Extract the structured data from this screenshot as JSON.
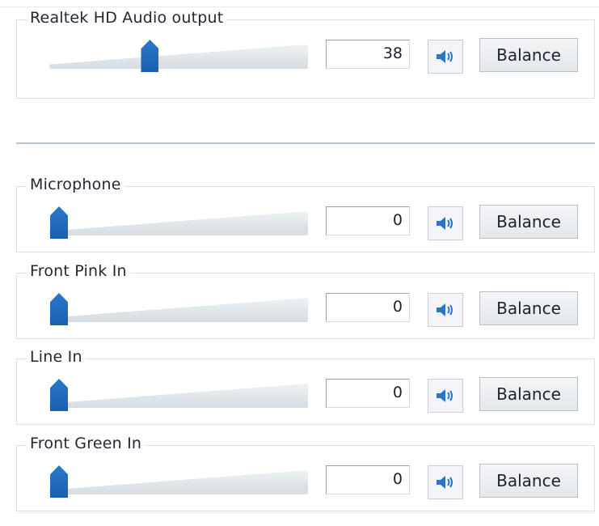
{
  "devices": [
    {
      "name": "Realtek HD Audio output",
      "value": "38",
      "level": 0.38,
      "balance_label": "Balance",
      "mute_icon": "speaker-icon"
    },
    {
      "name": "Microphone",
      "value": "0",
      "level": 0,
      "balance_label": "Balance",
      "mute_icon": "speaker-icon"
    },
    {
      "name": "Front Pink In",
      "value": "0",
      "level": 0,
      "balance_label": "Balance",
      "mute_icon": "speaker-icon"
    },
    {
      "name": "Line In",
      "value": "0",
      "level": 0,
      "balance_label": "Balance",
      "mute_icon": "speaker-icon"
    },
    {
      "name": "Front Green In",
      "value": "0",
      "level": 0,
      "balance_label": "Balance",
      "mute_icon": "speaker-icon"
    }
  ],
  "colors": {
    "thumb": "#1f67b8",
    "speaker_blue": "#2b74c6"
  }
}
